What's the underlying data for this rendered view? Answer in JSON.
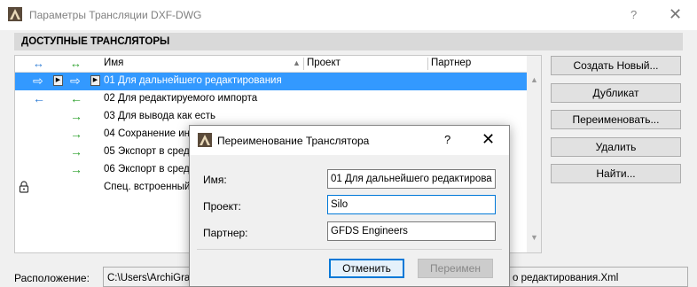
{
  "window": {
    "title": "Параметры Трансляции DXF-DWG",
    "help": "?",
    "close": "✕"
  },
  "section": {
    "title": "ДОСТУПНЫЕ ТРАНСЛЯТОРЫ"
  },
  "list": {
    "columns": {
      "name": "Имя",
      "project": "Проект",
      "partner": "Партнер"
    },
    "rows": [
      {
        "name": "01 Для дальнейшего редактирования"
      },
      {
        "name": "02 Для редактируемого импорта"
      },
      {
        "name": "03 Для вывода как есть"
      },
      {
        "name": "04 Сохранение ин"
      },
      {
        "name": "05 Экспорт в сред"
      },
      {
        "name": "06 Экспорт в сред"
      },
      {
        "name": "Спец. встроенный"
      }
    ]
  },
  "side_buttons": {
    "create": "Создать Новый...",
    "duplicate": "Дубликат",
    "rename": "Переименовать...",
    "delete": "Удалить",
    "find": "Найти..."
  },
  "location": {
    "label": "Расположение:",
    "path_start": "C:\\Users\\ArchiGrap",
    "path_end": "о редактирования.Xml"
  },
  "modal": {
    "title": "Переименование Транслятора",
    "help": "?",
    "close": "✕",
    "name_label": "Имя:",
    "name_value": "01 Для дальнейшего редактирова",
    "project_label": "Проект:",
    "project_value": "Silo",
    "partner_label": "Партнер:",
    "partner_value": "GFDS Engineers",
    "cancel": "Отменить",
    "rename": "Переимен"
  },
  "icons": {
    "app": "archicad-icon",
    "arrow_both": "⇨",
    "arrow_right": "→",
    "arrow_left": "←",
    "arrow_lr": "↔"
  },
  "colors": {
    "selection": "#3399ff",
    "focus": "#0078d7"
  }
}
